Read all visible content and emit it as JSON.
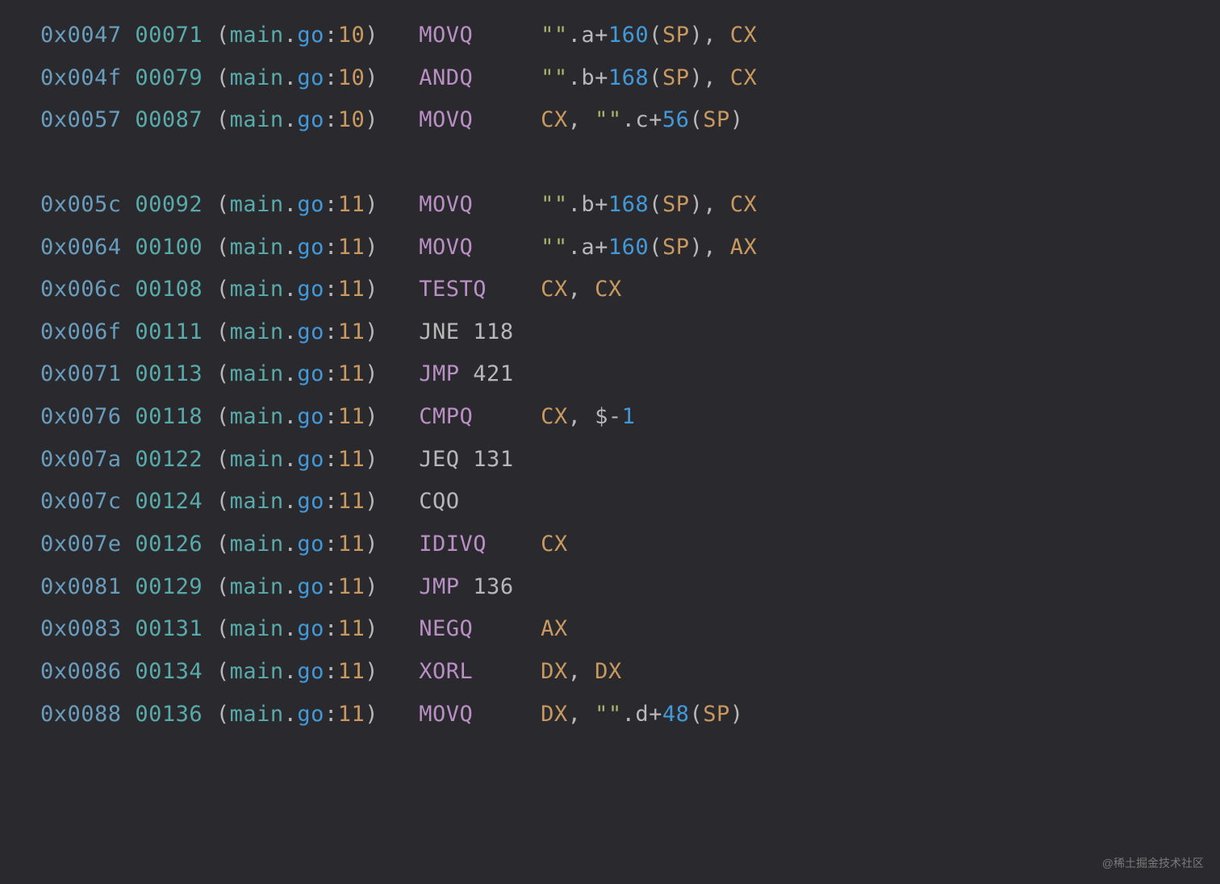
{
  "watermark": "@稀土掘金技术社区",
  "lines": [
    {
      "addr": "0x0047",
      "offset": "00071",
      "file": "main",
      "ext": "go",
      "lnum": "10",
      "mn": "MOVQ",
      "mnClass": "mnemonic",
      "ops": [
        {
          "t": "str",
          "v": "\"\""
        },
        {
          "t": "dot",
          "v": "."
        },
        {
          "t": "var",
          "v": "a"
        },
        {
          "t": "plus",
          "v": "+"
        },
        {
          "t": "num",
          "v": "160"
        },
        {
          "t": "paren",
          "v": "("
        },
        {
          "t": "reg",
          "v": "SP"
        },
        {
          "t": "paren",
          "v": ")"
        },
        {
          "t": "comma",
          "v": ", "
        },
        {
          "t": "reg",
          "v": "CX"
        }
      ]
    },
    {
      "addr": "0x004f",
      "offset": "00079",
      "file": "main",
      "ext": "go",
      "lnum": "10",
      "mn": "ANDQ",
      "mnClass": "mnemonic",
      "ops": [
        {
          "t": "str",
          "v": "\"\""
        },
        {
          "t": "dot",
          "v": "."
        },
        {
          "t": "var",
          "v": "b"
        },
        {
          "t": "plus",
          "v": "+"
        },
        {
          "t": "num",
          "v": "168"
        },
        {
          "t": "paren",
          "v": "("
        },
        {
          "t": "reg",
          "v": "SP"
        },
        {
          "t": "paren",
          "v": ")"
        },
        {
          "t": "comma",
          "v": ", "
        },
        {
          "t": "reg",
          "v": "CX"
        }
      ]
    },
    {
      "addr": "0x0057",
      "offset": "00087",
      "file": "main",
      "ext": "go",
      "lnum": "10",
      "mn": "MOVQ",
      "mnClass": "mnemonic",
      "ops": [
        {
          "t": "reg",
          "v": "CX"
        },
        {
          "t": "comma",
          "v": ", "
        },
        {
          "t": "str",
          "v": "\"\""
        },
        {
          "t": "dot",
          "v": "."
        },
        {
          "t": "var",
          "v": "c"
        },
        {
          "t": "plus",
          "v": "+"
        },
        {
          "t": "num",
          "v": "56"
        },
        {
          "t": "paren",
          "v": "("
        },
        {
          "t": "reg",
          "v": "SP"
        },
        {
          "t": "paren",
          "v": ")"
        }
      ]
    },
    {
      "blank": true
    },
    {
      "addr": "0x005c",
      "offset": "00092",
      "file": "main",
      "ext": "go",
      "lnum": "11",
      "mn": "MOVQ",
      "mnClass": "mnemonic",
      "ops": [
        {
          "t": "str",
          "v": "\"\""
        },
        {
          "t": "dot",
          "v": "."
        },
        {
          "t": "var",
          "v": "b"
        },
        {
          "t": "plus",
          "v": "+"
        },
        {
          "t": "num",
          "v": "168"
        },
        {
          "t": "paren",
          "v": "("
        },
        {
          "t": "reg",
          "v": "SP"
        },
        {
          "t": "paren",
          "v": ")"
        },
        {
          "t": "comma",
          "v": ", "
        },
        {
          "t": "reg",
          "v": "CX"
        }
      ]
    },
    {
      "addr": "0x0064",
      "offset": "00100",
      "file": "main",
      "ext": "go",
      "lnum": "11",
      "mn": "MOVQ",
      "mnClass": "mnemonic",
      "ops": [
        {
          "t": "str",
          "v": "\"\""
        },
        {
          "t": "dot",
          "v": "."
        },
        {
          "t": "var",
          "v": "a"
        },
        {
          "t": "plus",
          "v": "+"
        },
        {
          "t": "num",
          "v": "160"
        },
        {
          "t": "paren",
          "v": "("
        },
        {
          "t": "reg",
          "v": "SP"
        },
        {
          "t": "paren",
          "v": ")"
        },
        {
          "t": "comma",
          "v": ", "
        },
        {
          "t": "reg",
          "v": "AX"
        }
      ]
    },
    {
      "addr": "0x006c",
      "offset": "00108",
      "file": "main",
      "ext": "go",
      "lnum": "11",
      "mn": "TESTQ",
      "mnClass": "mnemonic",
      "ops": [
        {
          "t": "reg",
          "v": "CX"
        },
        {
          "t": "comma",
          "v": ", "
        },
        {
          "t": "reg",
          "v": "CX"
        }
      ]
    },
    {
      "addr": "0x006f",
      "offset": "00111",
      "file": "main",
      "ext": "go",
      "lnum": "11",
      "mn": "JNE",
      "mnClass": "mnemonic-j",
      "jmpRaw": " 118",
      "ops": []
    },
    {
      "addr": "0x0071",
      "offset": "00113",
      "file": "main",
      "ext": "go",
      "lnum": "11",
      "mn": "JMP",
      "mnClass": "mnemonic",
      "jmpRaw": " 421",
      "ops": []
    },
    {
      "addr": "0x0076",
      "offset": "00118",
      "file": "main",
      "ext": "go",
      "lnum": "11",
      "mn": "CMPQ",
      "mnClass": "mnemonic",
      "ops": [
        {
          "t": "reg",
          "v": "CX"
        },
        {
          "t": "comma",
          "v": ", "
        },
        {
          "t": "dollar",
          "v": "$-"
        },
        {
          "t": "num",
          "v": "1"
        }
      ]
    },
    {
      "addr": "0x007a",
      "offset": "00122",
      "file": "main",
      "ext": "go",
      "lnum": "11",
      "mn": "JEQ",
      "mnClass": "mnemonic-j",
      "jmpRaw": " 131",
      "ops": []
    },
    {
      "addr": "0x007c",
      "offset": "00124",
      "file": "main",
      "ext": "go",
      "lnum": "11",
      "mn": "CQO",
      "mnClass": "mnemonic-j",
      "ops": []
    },
    {
      "addr": "0x007e",
      "offset": "00126",
      "file": "main",
      "ext": "go",
      "lnum": "11",
      "mn": "IDIVQ",
      "mnClass": "mnemonic",
      "ops": [
        {
          "t": "reg",
          "v": "CX"
        }
      ]
    },
    {
      "addr": "0x0081",
      "offset": "00129",
      "file": "main",
      "ext": "go",
      "lnum": "11",
      "mn": "JMP",
      "mnClass": "mnemonic",
      "jmpRaw": " 136",
      "ops": []
    },
    {
      "addr": "0x0083",
      "offset": "00131",
      "file": "main",
      "ext": "go",
      "lnum": "11",
      "mn": "NEGQ",
      "mnClass": "mnemonic",
      "ops": [
        {
          "t": "reg",
          "v": "AX"
        }
      ]
    },
    {
      "addr": "0x0086",
      "offset": "00134",
      "file": "main",
      "ext": "go",
      "lnum": "11",
      "mn": "XORL",
      "mnClass": "mnemonic",
      "ops": [
        {
          "t": "reg",
          "v": "DX"
        },
        {
          "t": "comma",
          "v": ", "
        },
        {
          "t": "reg",
          "v": "DX"
        }
      ]
    },
    {
      "addr": "0x0088",
      "offset": "00136",
      "file": "main",
      "ext": "go",
      "lnum": "11",
      "mn": "MOVQ",
      "mnClass": "mnemonic",
      "ops": [
        {
          "t": "reg",
          "v": "DX"
        },
        {
          "t": "comma",
          "v": ", "
        },
        {
          "t": "str",
          "v": "\"\""
        },
        {
          "t": "dot",
          "v": "."
        },
        {
          "t": "var",
          "v": "d"
        },
        {
          "t": "plus",
          "v": "+"
        },
        {
          "t": "num",
          "v": "48"
        },
        {
          "t": "paren",
          "v": "("
        },
        {
          "t": "reg",
          "v": "SP"
        },
        {
          "t": "paren",
          "v": ")"
        }
      ]
    }
  ]
}
